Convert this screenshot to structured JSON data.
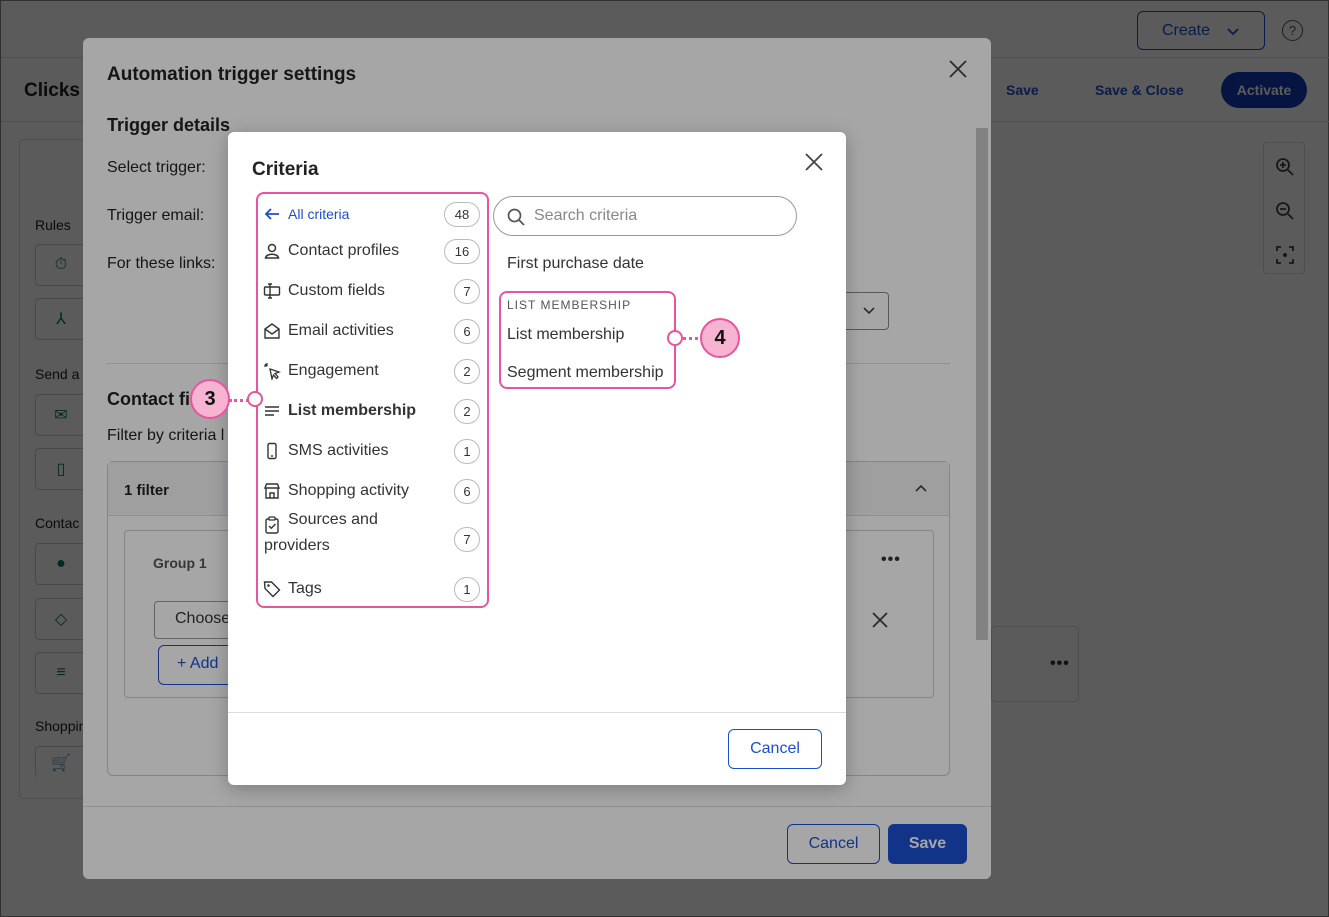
{
  "topbar": {
    "create_label": "Create",
    "help_label": "?"
  },
  "subbar": {
    "title": "Clicks t",
    "save_label": "Save",
    "save_close_label": "Save & Close",
    "activate_label": "Activate"
  },
  "left_panel": {
    "rules_label": "Rules",
    "send_label": "Send a",
    "contact_label": "Contac",
    "shopping_label": "Shoppin"
  },
  "trigger_modal": {
    "title": "Automation trigger settings",
    "trigger_details": "Trigger details",
    "select_trigger_label": "Select trigger:",
    "trigger_email_label": "Trigger email:",
    "links_label": "For these links:",
    "contact_filter_label": "Contact fi",
    "filter_by_label": "Filter by criteria l",
    "filter_count": "1 filter",
    "group_title": "Group 1",
    "choose_value": "Choose",
    "add_label": "Add",
    "cancel_label": "Cancel",
    "save_label": "Save"
  },
  "criteria_modal": {
    "title": "Criteria",
    "search_placeholder": "Search criteria",
    "categories": [
      {
        "label": "All criteria",
        "count": "48",
        "icon": "arrow-left-icon"
      },
      {
        "label": "Contact profiles",
        "count": "16",
        "icon": "person-icon"
      },
      {
        "label": "Custom fields",
        "count": "7",
        "icon": "custom-field-icon"
      },
      {
        "label": "Email activities",
        "count": "6",
        "icon": "envelope-open-icon"
      },
      {
        "label": "Engagement",
        "count": "2",
        "icon": "cursor-click-icon"
      },
      {
        "label": "List membership",
        "count": "2",
        "icon": "list-lines-icon"
      },
      {
        "label": "SMS activities",
        "count": "1",
        "icon": "mobile-phone-icon"
      },
      {
        "label": "Shopping activity",
        "count": "6",
        "icon": "storefront-icon"
      },
      {
        "label_line1": "Sources and",
        "label_line2": "providers",
        "count": "7",
        "icon": "clipboard-check-icon"
      },
      {
        "label": "Tags",
        "count": "1",
        "icon": "tag-icon"
      }
    ],
    "first_purchase": "First purchase date",
    "list_membership_header": "LIST MEMBERSHIP",
    "list_membership_items": [
      "List membership",
      "Segment membership"
    ],
    "cancel_label": "Cancel"
  },
  "callouts": {
    "left": "3",
    "right": "4"
  },
  "colors": {
    "accent": "#1b4fd1",
    "highlight": "#e8559c",
    "callout_fill": "#f6b3d2"
  }
}
